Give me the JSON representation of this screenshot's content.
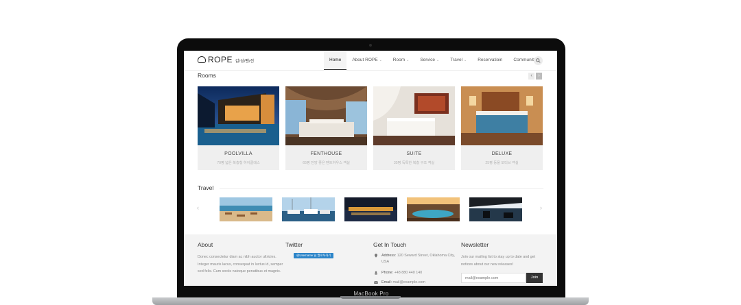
{
  "device": {
    "label": "MacBook Pro"
  },
  "site": {
    "logo_text": "ROPE",
    "logo_sub": "갑/성/펜/션",
    "nav": [
      {
        "label": "Home",
        "caret": false
      },
      {
        "label": "About ROPE",
        "caret": true
      },
      {
        "label": "Room",
        "caret": true
      },
      {
        "label": "Service",
        "caret": true
      },
      {
        "label": "Travel",
        "caret": true
      },
      {
        "label": "Reservatioin",
        "caret": false
      },
      {
        "label": "Community",
        "caret": false
      }
    ],
    "nav_active": "Home"
  },
  "rooms": {
    "title": "Rooms",
    "prev": "‹",
    "next": "›",
    "items": [
      {
        "name": "POOLVILLA",
        "desc": "70평 넓은 복층형 하이클래스"
      },
      {
        "name": "FENTHOUSE",
        "desc": "65평 전망 좋은 펜트하우스 객실"
      },
      {
        "name": "SUITE",
        "desc": "35평 독특한 복층 구조 객실"
      },
      {
        "name": "DELUXE",
        "desc": "25평 동물 모티브 객실"
      }
    ]
  },
  "travel": {
    "title": "Travel",
    "prev": "‹",
    "next": "›"
  },
  "footer": {
    "about": {
      "title": "About",
      "text": "Donec consectetur diam ac nibh auctor ultricies. Integer mauris lacus, consequat in luctus id, semper sed felis. Cum sociis natoque penatibus et magnis."
    },
    "twitter": {
      "title": "Twitter",
      "badge": "@Username 님 팔로우하기"
    },
    "contact": {
      "title": "Get In Touch",
      "address_label": "Address:",
      "address_value": "120 Seward Street, Oklahoma City, USA",
      "phone_label": "Phone:",
      "phone_value": "+48 880 440 140",
      "email_label": "Email:",
      "email_value": "mail@example.com"
    },
    "newsletter": {
      "title": "Newsletter",
      "text": "Join our mailing list to stay up to date and get notices about our new releases!",
      "placeholder": "mail@example.com",
      "button": "Join"
    }
  },
  "colors": {
    "footer_bg": "#f3f3f3",
    "twitter_blue": "#2c85c9",
    "button_dark": "#333333"
  }
}
